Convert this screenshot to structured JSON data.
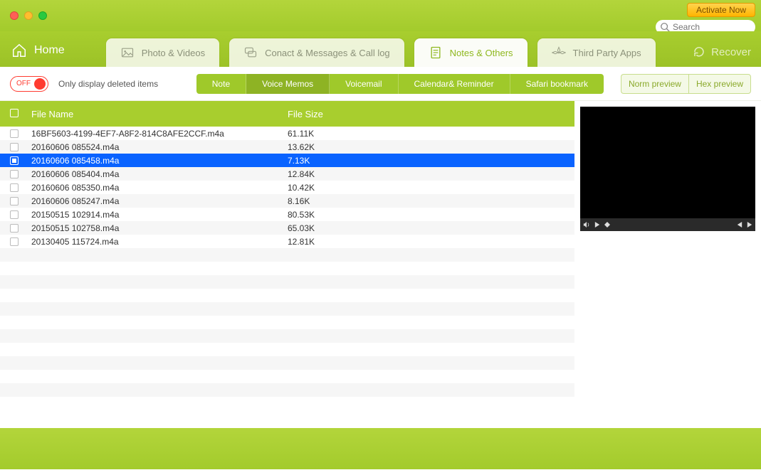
{
  "top": {
    "activate": "Activate Now",
    "search_placeholder": "Search"
  },
  "nav": {
    "home": "Home",
    "tabs": [
      {
        "label": "Photo & Videos"
      },
      {
        "label": "Conact & Messages & Call log"
      },
      {
        "label": "Notes & Others"
      },
      {
        "label": "Third Party Apps"
      }
    ],
    "recover": "Recover"
  },
  "filter": {
    "toggle_text": "OFF",
    "toggle_label": "Only display deleted items",
    "subtabs": [
      "Note",
      "Voice Memos",
      "Voicemail",
      "Calendar& Reminder",
      "Safari bookmark"
    ],
    "active_subtab": 1,
    "preview_buttons": [
      "Norm preview",
      "Hex preview"
    ]
  },
  "table": {
    "columns": {
      "name": "File Name",
      "size": "File Size"
    },
    "rows": [
      {
        "name": "16BF5603-4199-4EF7-A8F2-814C8AFE2CCF.m4a",
        "size": "61.11K",
        "selected": false
      },
      {
        "name": "20160606 085524.m4a",
        "size": "13.62K",
        "selected": false
      },
      {
        "name": "20160606 085458.m4a",
        "size": "7.13K",
        "selected": true
      },
      {
        "name": "20160606 085404.m4a",
        "size": "12.84K",
        "selected": false
      },
      {
        "name": "20160606 085350.m4a",
        "size": "10.42K",
        "selected": false
      },
      {
        "name": "20160606 085247.m4a",
        "size": "8.16K",
        "selected": false
      },
      {
        "name": "20150515 102914.m4a",
        "size": "80.53K",
        "selected": false
      },
      {
        "name": "20150515 102758.m4a",
        "size": "65.03K",
        "selected": false
      },
      {
        "name": "20130405 115724.m4a",
        "size": "12.81K",
        "selected": false
      }
    ],
    "empty_stripes": 12
  }
}
